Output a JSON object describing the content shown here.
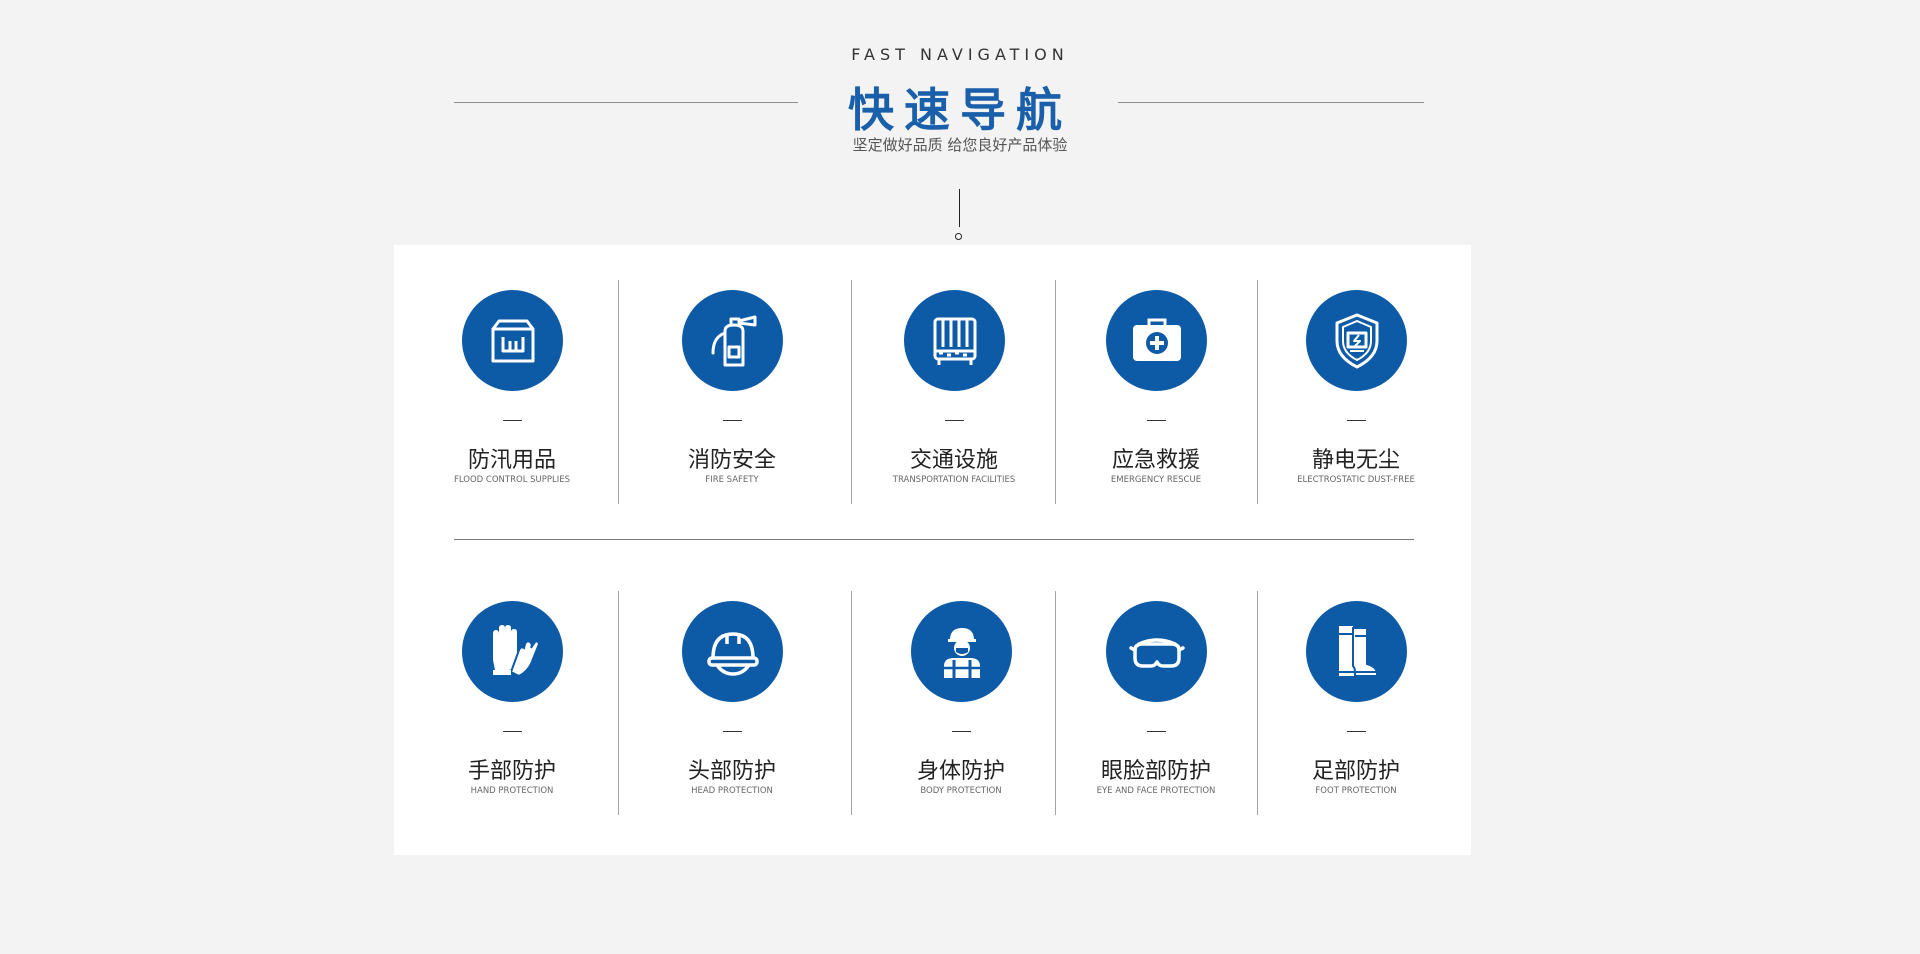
{
  "header": {
    "eyebrow": "FAST NAVIGATION",
    "title": "快速导航",
    "subtitle": "坚定做好品质 给您良好产品体验"
  },
  "colors": {
    "accent": "#1a5fa9",
    "icon_bg": "#0d5aa7",
    "page_bg": "#f3f3f3",
    "panel_bg": "#ffffff"
  },
  "categories": [
    {
      "cn": "防汛用品",
      "en": "FLOOD CONTROL SUPPLIES",
      "icon": "flood-box-icon"
    },
    {
      "cn": "消防安全",
      "en": "FIRE SAFETY",
      "icon": "fire-extinguisher-icon"
    },
    {
      "cn": "交通设施",
      "en": "TRANSPORTATION FACILITIES",
      "icon": "traffic-barrier-icon"
    },
    {
      "cn": "应急救援",
      "en": "EMERGENCY RESCUE",
      "icon": "first-aid-kit-icon"
    },
    {
      "cn": "静电无尘",
      "en": "ELECTROSTATIC DUST-FREE",
      "icon": "electrostatic-shield-icon"
    },
    {
      "cn": "手部防护",
      "en": "HAND PROTECTION",
      "icon": "gloves-icon"
    },
    {
      "cn": "头部防护",
      "en": "HEAD PROTECTION",
      "icon": "hard-hat-icon"
    },
    {
      "cn": "身体防护",
      "en": "BODY PROTECTION",
      "icon": "worker-icon"
    },
    {
      "cn": "眼脸部防护",
      "en": "EYE AND FACE PROTECTION",
      "icon": "goggles-icon"
    },
    {
      "cn": "足部防护",
      "en": "FOOT PROTECTION",
      "icon": "boots-icon"
    }
  ]
}
